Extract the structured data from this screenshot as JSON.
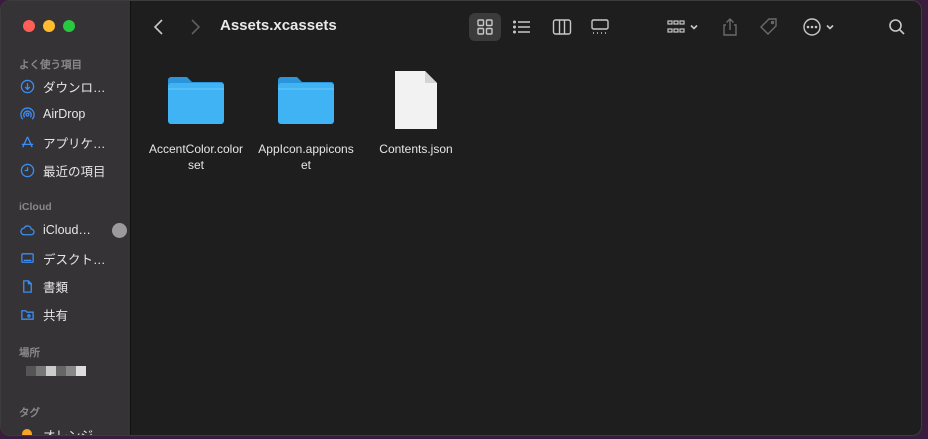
{
  "window": {
    "title": "Assets.xcassets"
  },
  "sidebar": {
    "sections": [
      {
        "title": "よく使う項目",
        "items": [
          {
            "label": "ダウンロ…",
            "icon": "download-icon"
          },
          {
            "label": "AirDrop",
            "icon": "airdrop-icon"
          },
          {
            "label": "アプリケ…",
            "icon": "applications-icon"
          },
          {
            "label": "最近の項目",
            "icon": "clock-icon"
          }
        ]
      },
      {
        "title": "iCloud",
        "items": [
          {
            "label": "iCloud…",
            "icon": "cloud-icon"
          },
          {
            "label": "デスクト…",
            "icon": "desktop-icon"
          },
          {
            "label": "書類",
            "icon": "document-icon"
          },
          {
            "label": "共有",
            "icon": "shared-folder-icon"
          }
        ]
      },
      {
        "title": "場所",
        "items": []
      },
      {
        "title": "タグ",
        "items": [
          {
            "label": "オレンジ",
            "icon": "orange-tag-dot"
          }
        ]
      }
    ]
  },
  "files": [
    {
      "name": "AccentColor.colorset",
      "icon": "folder-icon"
    },
    {
      "name": "AppIcon.appiconset",
      "icon": "folder-icon"
    },
    {
      "name": "Contents.json",
      "icon": "document-file-icon"
    }
  ],
  "colors": {
    "accent": "#3b8ef3",
    "folder": "#3fb3f4",
    "tag_orange": "#f6a623"
  }
}
